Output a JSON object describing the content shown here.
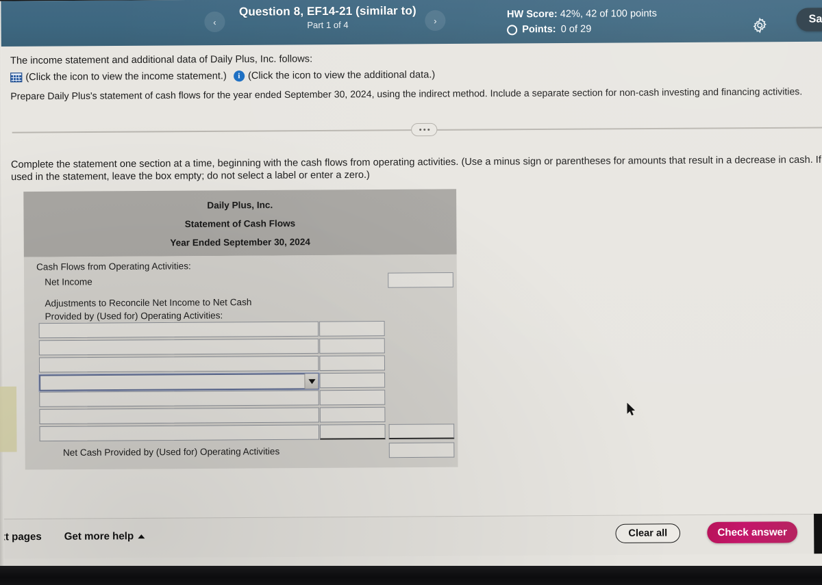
{
  "header": {
    "question_title": "Question 8, EF14-21 (similar to)",
    "part_label": "Part 1 of 4",
    "prev_icon": "‹",
    "next_icon": "›",
    "hw_score_label": "HW Score:",
    "hw_score_value": " 42%, 42 of 100 points",
    "points_label": "Points:",
    "points_value": " 0 of 29",
    "save_label": "Sa",
    "accent_color": "#3d6780"
  },
  "problem": {
    "intro": "The income statement and additional data of Daily Plus, Inc. follows:",
    "income_statement_link": "(Click the icon to view the income statement.)",
    "additional_data_link": "(Click the icon to view the additional data.)",
    "instruction": "Prepare Daily Plus's statement of cash flows for the year ended September 30, 2024, using the indirect method. Include a separate section for non-cash investing and financing activities.",
    "complete_line_1": "Complete the statement one section at a time, beginning with the cash flows from operating activities. (Use a minus sign or parentheses for amounts that result in a decrease in cash. If a box is n",
    "complete_line_2": "used in the statement, leave the box empty; do not select a label or enter a zero.)"
  },
  "statement": {
    "company": "Daily Plus, Inc.",
    "title": "Statement of Cash Flows",
    "period": "Year Ended September 30, 2024",
    "section_header": "Cash Flows from Operating Activities:",
    "net_income_label": "Net Income",
    "net_income_value": "",
    "adjustments_line_1": "Adjustments to Reconcile Net Income to Net Cash",
    "adjustments_line_2": "Provided by (Used for) Operating Activities:",
    "entry_rows": [
      {
        "label": "",
        "amount": "",
        "selected": false,
        "dropdown": false,
        "underlined": false,
        "has_total": false
      },
      {
        "label": "",
        "amount": "",
        "selected": false,
        "dropdown": false,
        "underlined": false,
        "has_total": false
      },
      {
        "label": "",
        "amount": "",
        "selected": false,
        "dropdown": false,
        "underlined": false,
        "has_total": false
      },
      {
        "label": "",
        "amount": "",
        "selected": true,
        "dropdown": true,
        "underlined": false,
        "has_total": false
      },
      {
        "label": "",
        "amount": "",
        "selected": false,
        "dropdown": false,
        "underlined": false,
        "has_total": false
      },
      {
        "label": "",
        "amount": "",
        "selected": false,
        "dropdown": false,
        "underlined": false,
        "has_total": false
      },
      {
        "label": "",
        "amount": "",
        "selected": false,
        "dropdown": false,
        "underlined": true,
        "has_total": true
      }
    ],
    "net_cash_label": "Net Cash Provided by (Used for) Operating Activities",
    "net_cash_value": ""
  },
  "footer": {
    "next_pages": "ext pages",
    "get_more_help": "Get more help",
    "clear_all": "Clear all",
    "check_answer": "Check answer",
    "check_answer_color": "#bd1460"
  }
}
